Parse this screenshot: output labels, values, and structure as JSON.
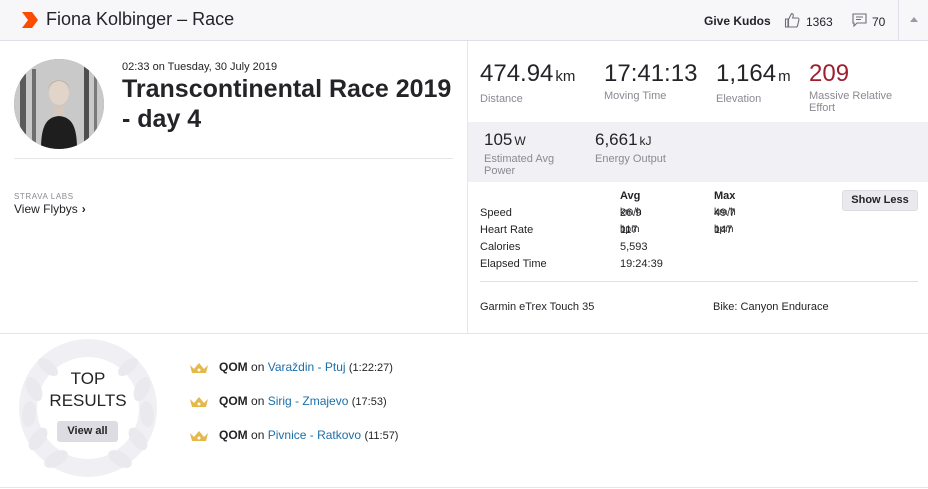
{
  "header": {
    "title": "Fiona Kolbinger – Race",
    "give_kudos": "Give Kudos",
    "kudos_count": "1363",
    "comment_count": "70",
    "colors": {
      "brand": "#fc4c02",
      "background": "#f7f7fa"
    }
  },
  "activity": {
    "date": "02:33 on Tuesday, 30 July 2019",
    "title": "Transcontinental Race 2019 - day 4"
  },
  "labs": {
    "label": "STRAVA LABS",
    "flybys": "View Flybys",
    "chevron": "›"
  },
  "primary_stats": [
    {
      "value": "474.94",
      "unit": "km",
      "label": "Distance"
    },
    {
      "value": "17:41:13",
      "unit": "",
      "label": "Moving Time"
    },
    {
      "value": "1,164",
      "unit": "m",
      "label": "Elevation"
    },
    {
      "value": "209",
      "unit": "",
      "label": "Massive Relative Effort",
      "color": "#9e1f2e"
    }
  ],
  "secondary_stats": [
    {
      "value": "105",
      "unit": "W",
      "label": "Estimated Avg Power"
    },
    {
      "value": "6,661",
      "unit": "kJ",
      "label": "Energy Output"
    }
  ],
  "more_stats": {
    "avg_header": "Avg",
    "max_header": "Max",
    "rows": [
      {
        "label": "Speed",
        "avg": "26.9",
        "avg_unit": "km/h",
        "max": "49.7",
        "max_unit": "km/h"
      },
      {
        "label": "Heart Rate",
        "avg": "117",
        "avg_unit": "bpm",
        "max": "147",
        "max_unit": "bpm"
      },
      {
        "label": "Calories",
        "avg": "5,593",
        "avg_unit": "",
        "max": "",
        "max_unit": ""
      },
      {
        "label": "Elapsed Time",
        "avg": "19:24:39",
        "avg_unit": "",
        "max": "",
        "max_unit": ""
      }
    ],
    "show_less": "Show Less"
  },
  "gear": {
    "device": "Garmin eTrex Touch 35",
    "bike": "Bike: Canyon Endurace"
  },
  "top_results": {
    "heading_line1": "TOP",
    "heading_line2": "RESULTS",
    "view_all": "View all",
    "achievements": [
      {
        "badge": "QOM",
        "on": "on",
        "segment": "Varaždin - Ptuj",
        "time": "(1:22:27)"
      },
      {
        "badge": "QOM",
        "on": "on",
        "segment": "Sirig - Zmajevo",
        "time": "(17:53)"
      },
      {
        "badge": "QOM",
        "on": "on",
        "segment": "Pivnice - Ratkovo",
        "time": "(11:57)"
      }
    ],
    "colors": {
      "crown": "#e5b84a",
      "segment_link": "#1b6fa8"
    }
  }
}
